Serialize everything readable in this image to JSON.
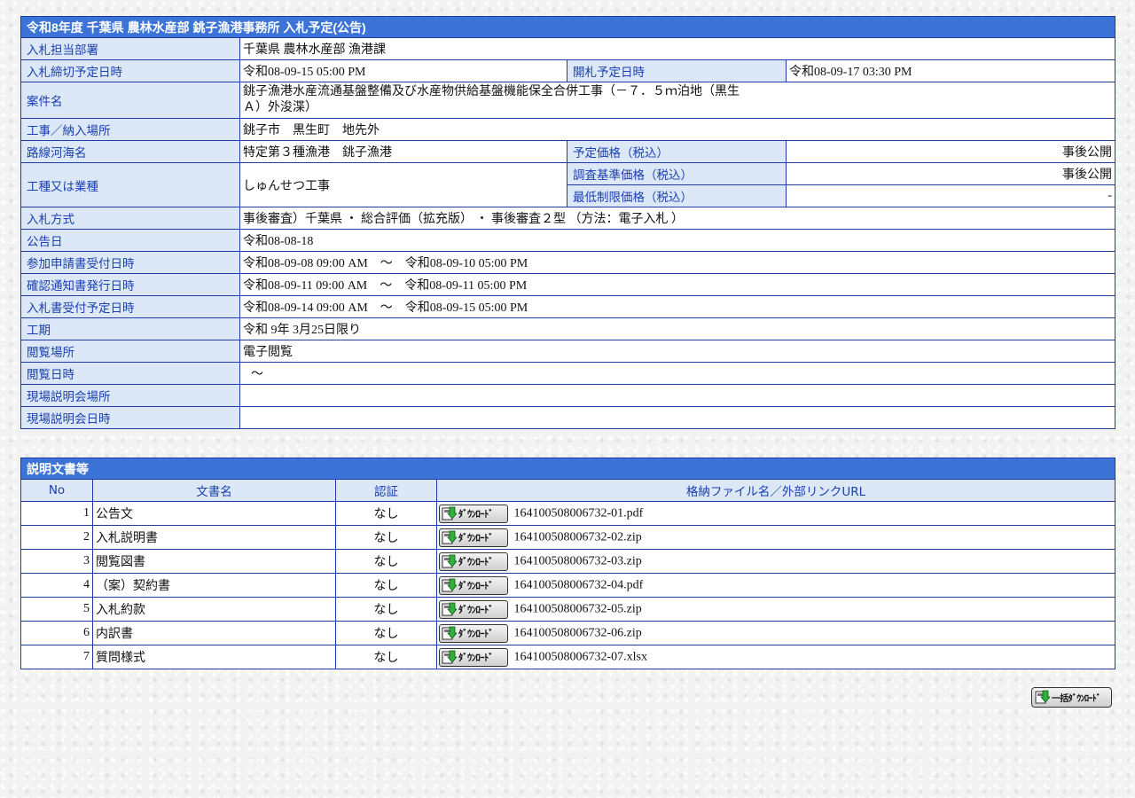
{
  "main": {
    "title": "令和8年度 千葉県 農林水産部 銚子漁港事務所 入札予定(公告)",
    "rows": {
      "department": {
        "label": "入札担当部署",
        "value": "千葉県 農林水産部 漁港課"
      },
      "deadline": {
        "label": "入札締切予定日時",
        "value": "令和08-09-15 05:00 PM"
      },
      "opening": {
        "label": "開札予定日時",
        "value": "令和08-09-17 03:30 PM"
      },
      "project": {
        "label": "案件名",
        "value": "銚子漁港水産流通基盤整備及び水産物供給基盤機能保全合併工事（－７．５ｍ泊地（黒生Ａ）外浚渫）"
      },
      "location": {
        "label": "工事／納入場所",
        "value": "銚子市　黒生町　地先外"
      },
      "route": {
        "label": "路線河海名",
        "value": "特定第３種漁港　銚子漁港"
      },
      "planned_price": {
        "label": "予定価格（税込）",
        "value": "事後公開"
      },
      "work_type": {
        "label": "工種又は業種",
        "value": "しゅんせつ工事"
      },
      "survey_price": {
        "label": "調査基準価格（税込）",
        "value": "事後公開"
      },
      "min_price": {
        "label": "最低制限価格（税込）",
        "value": "-"
      },
      "method": {
        "label": "入札方式",
        "value": "事後審査）千葉県 ・ 総合評価（拡充版） ・ 事後審査２型 （方法：電子入札 ）"
      },
      "notice_date": {
        "label": "公告日",
        "value": "令和08-08-18"
      },
      "application": {
        "label": "参加申請書受付日時",
        "value": "令和08-09-08 09:00 AM　～　令和08-09-10 05:00 PM"
      },
      "confirmation": {
        "label": "確認通知書発行日時",
        "value": "令和08-09-11 09:00 AM　～　令和08-09-11 05:00 PM"
      },
      "bid_receipt": {
        "label": "入札書受付予定日時",
        "value": "令和08-09-14 09:00 AM　～　令和08-09-15 05:00 PM"
      },
      "period": {
        "label": "工期",
        "value": "令和 9年 3月25日限り"
      },
      "viewing_place": {
        "label": "閲覧場所",
        "value": "電子閲覧"
      },
      "viewing_date": {
        "label": "閲覧日時",
        "value": "～"
      },
      "briefing_place": {
        "label": "現場説明会場所",
        "value": ""
      },
      "briefing_date": {
        "label": "現場説明会日時",
        "value": ""
      }
    }
  },
  "docs": {
    "title": "説明文書等",
    "headers": {
      "no": "No",
      "name": "文書名",
      "auth": "認証",
      "file": "格納ファイル名／外部リンクURL"
    },
    "download_label": "ﾀﾞｳﾝﾛｰﾄﾞ",
    "rows": [
      {
        "no": "1",
        "name": "公告文",
        "auth": "なし",
        "file": "164100508006732-01.pdf"
      },
      {
        "no": "2",
        "name": "入札説明書",
        "auth": "なし",
        "file": "164100508006732-02.zip"
      },
      {
        "no": "3",
        "name": "閲覧図書",
        "auth": "なし",
        "file": "164100508006732-03.zip"
      },
      {
        "no": "4",
        "name": "（案）契約書",
        "auth": "なし",
        "file": "164100508006732-04.pdf"
      },
      {
        "no": "5",
        "name": "入札約款",
        "auth": "なし",
        "file": "164100508006732-05.zip"
      },
      {
        "no": "6",
        "name": "内訳書",
        "auth": "なし",
        "file": "164100508006732-06.zip"
      },
      {
        "no": "7",
        "name": "質問様式",
        "auth": "なし",
        "file": "164100508006732-07.xlsx"
      }
    ]
  },
  "bulk_download_label": "一括ﾀﾞｳﾝﾛｰﾄﾞ",
  "icons": {
    "download": "download-arrow-icon"
  },
  "colors": {
    "header": "#3b74d6",
    "label_bg": "#dce8f8",
    "label_text": "#1a3fae",
    "border": "#1f3aa6"
  }
}
